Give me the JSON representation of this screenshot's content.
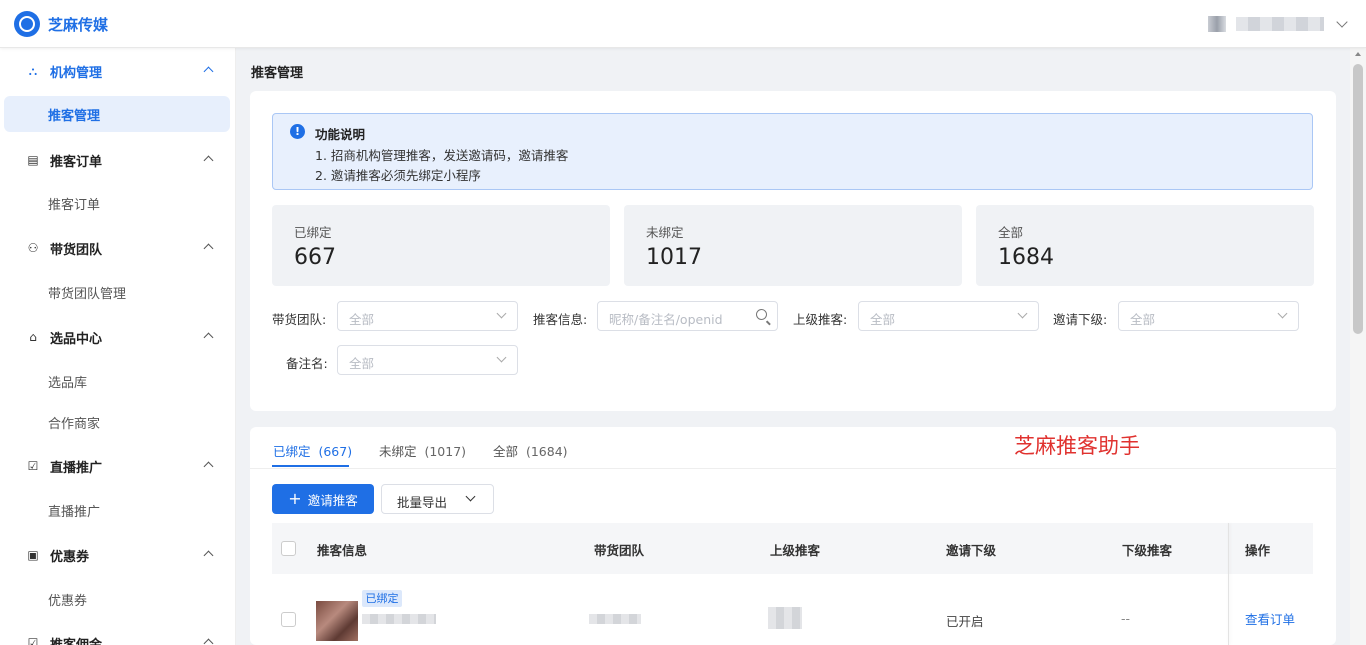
{
  "app": {
    "brand": "芝麻传媒"
  },
  "sidebar": {
    "groups": [
      {
        "label": "机构管理",
        "icon": "org-icon",
        "sub": [
          "推客管理"
        ]
      },
      {
        "label": "推客订单",
        "icon": "order-icon",
        "sub": [
          "推客订单"
        ]
      },
      {
        "label": "带货团队",
        "icon": "team-icon",
        "sub": [
          "带货团队管理"
        ]
      },
      {
        "label": "选品中心",
        "icon": "shop-icon",
        "sub": [
          "选品库",
          "合作商家"
        ]
      },
      {
        "label": "直播推广",
        "icon": "live-icon",
        "sub": [
          "直播推广"
        ]
      },
      {
        "label": "优惠券",
        "icon": "coupon-icon",
        "sub": [
          "优惠券"
        ]
      },
      {
        "label": "推客佣金",
        "icon": "commission-icon",
        "sub": []
      }
    ]
  },
  "page": {
    "title": "推客管理"
  },
  "notice": {
    "title": "功能说明",
    "line1": "1. 招商机构管理推客，发送邀请码，邀请推客",
    "line2": "2. 邀请推客必须先绑定小程序"
  },
  "stats": [
    {
      "label": "已绑定",
      "value": "667"
    },
    {
      "label": "未绑定",
      "value": "1017"
    },
    {
      "label": "全部",
      "value": "1684"
    }
  ],
  "filters": {
    "team_label": "带货团队:",
    "team_value": "全部",
    "info_label": "推客信息:",
    "info_placeholder": "昵称/备注名/openid",
    "parent_label": "上级推客:",
    "parent_value": "全部",
    "invite_label": "邀请下级:",
    "invite_value": "全部",
    "remark_label": "备注名:",
    "remark_value": "全部"
  },
  "tabs": [
    {
      "label": "已绑定",
      "count": "(667)"
    },
    {
      "label": "未绑定",
      "count": "(1017)"
    },
    {
      "label": "全部",
      "count": "(1684)"
    }
  ],
  "watermark": "芝麻推客助手",
  "toolbar": {
    "invite_label": "邀请推客",
    "export_label": "批量导出"
  },
  "table": {
    "headers": [
      "推客信息",
      "带货团队",
      "上级推客",
      "邀请下级",
      "下级推客",
      "操作"
    ],
    "row": {
      "badge": "已绑定",
      "invite": "已开启",
      "children": "--",
      "action": "查看订单"
    }
  },
  "colors": {
    "primary": "#1f6fe5",
    "watermark": "#e0322f"
  }
}
